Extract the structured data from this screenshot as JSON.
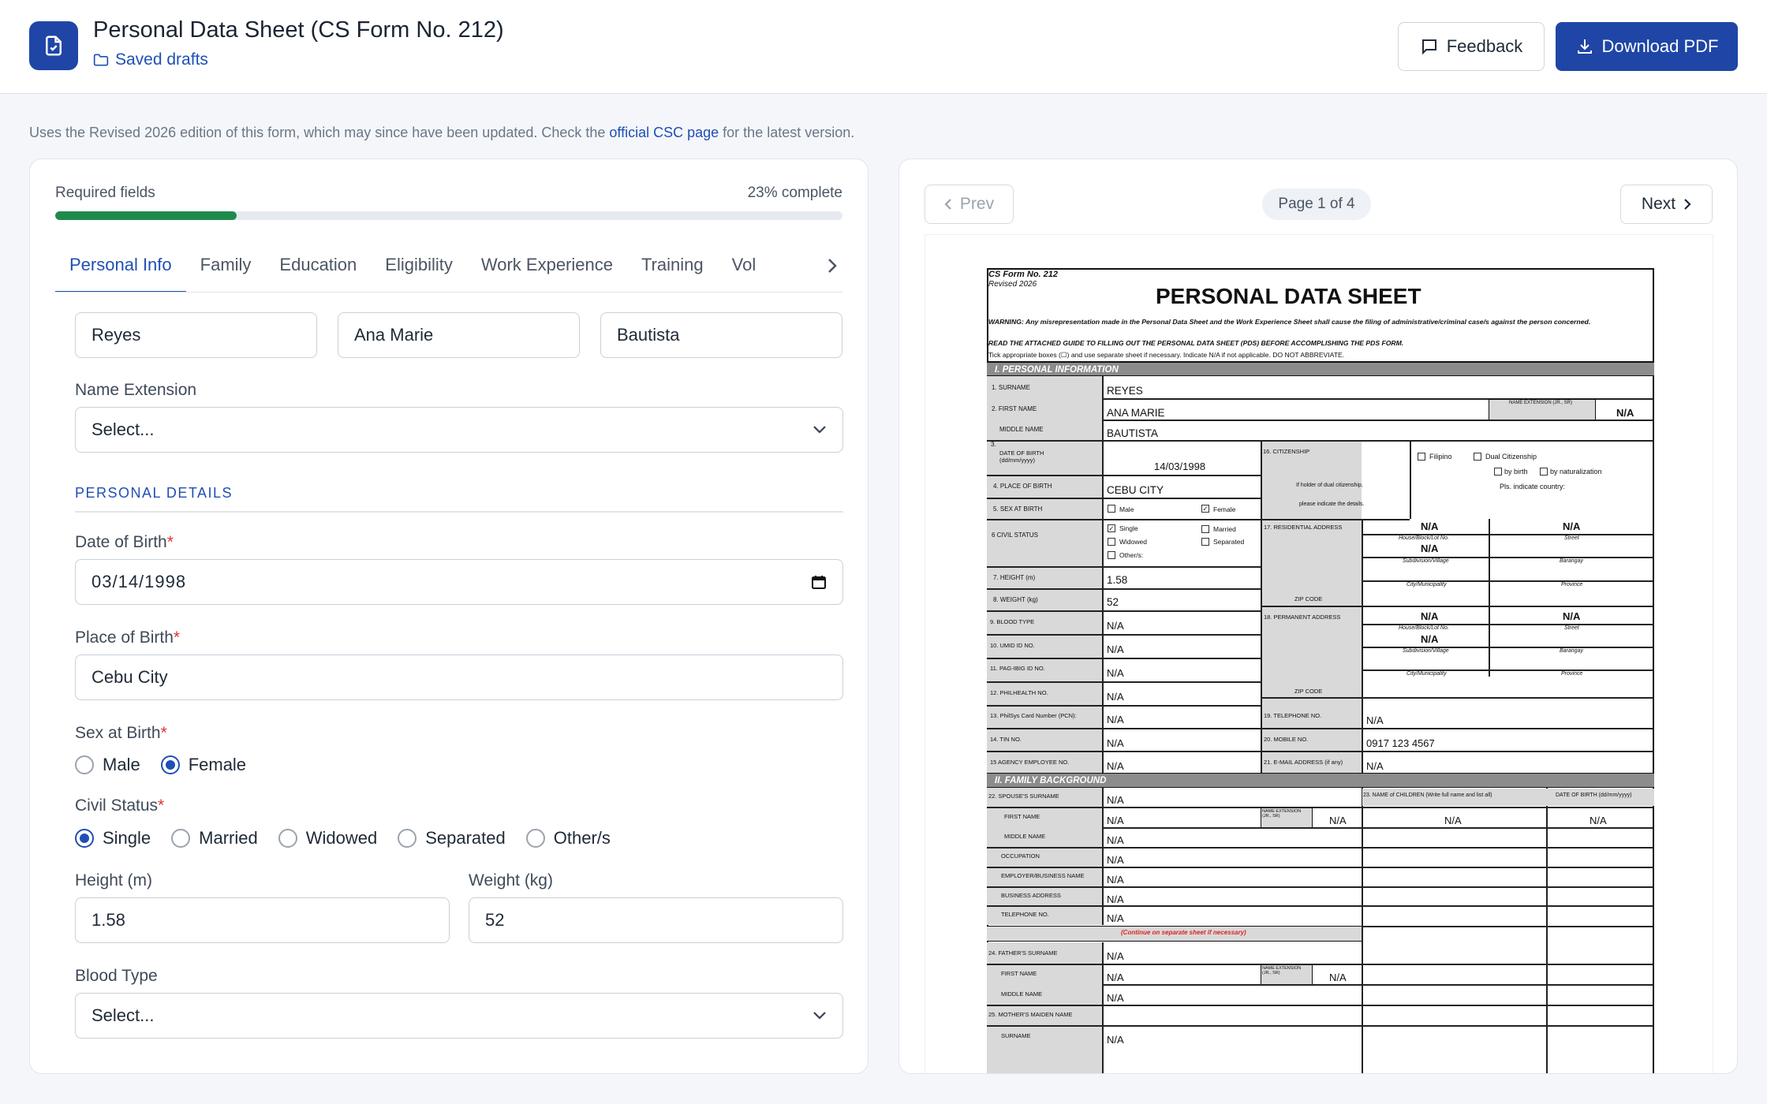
{
  "header": {
    "title": "Personal Data Sheet (CS Form No. 212)",
    "drafts_link": "Saved drafts",
    "feedback_label": "Feedback",
    "download_label": "Download PDF"
  },
  "notice": {
    "prefix": "Uses the Revised 2026 edition of this form, which may since have been updated. Check the ",
    "link": "official CSC page",
    "suffix": " for the latest version."
  },
  "form": {
    "required_label": "Required fields",
    "progress_text": "23% complete",
    "progress_fraction": 0.23,
    "tabs": [
      {
        "label": "Personal Info"
      },
      {
        "label": "Family"
      },
      {
        "label": "Education"
      },
      {
        "label": "Eligibility"
      },
      {
        "label": "Work Experience"
      },
      {
        "label": "Training"
      },
      {
        "label": "Vol"
      }
    ],
    "surname": "Reyes",
    "first_name": "Ana Marie",
    "middle_name": "Bautista",
    "name_extension": {
      "label": "Name Extension",
      "value": "Select..."
    },
    "section_title": "PERSONAL DETAILS",
    "dob": {
      "label": "Date of Birth",
      "value": "03/14/1998"
    },
    "pob": {
      "label": "Place of Birth",
      "value": "Cebu City"
    },
    "sex": {
      "label": "Sex at Birth",
      "options": [
        "Male",
        "Female"
      ],
      "selected": "Female"
    },
    "civil": {
      "label": "Civil Status",
      "options": [
        "Single",
        "Married",
        "Widowed",
        "Separated",
        "Other/s"
      ],
      "selected": "Single"
    },
    "height": {
      "label": "Height (m)",
      "value": "1.58"
    },
    "weight": {
      "label": "Weight (kg)",
      "value": "52"
    },
    "blood": {
      "label": "Blood Type",
      "value": "Select..."
    },
    "required_mark": "*"
  },
  "preview": {
    "prev_label": "Prev",
    "next_label": "Next",
    "page_indicator": "Page 1 of 4"
  },
  "doc": {
    "form_no": "CS Form No. 212",
    "revised": "Revised 2026",
    "title": "PERSONAL DATA SHEET",
    "warning": "WARNING: Any misrepresentation made in the Personal Data Sheet and the Work Experience Sheet shall cause the filing of administrative/criminal case/s against the person concerned.",
    "read": "READ THE ATTACHED GUIDE TO FILLING OUT THE PERSONAL DATA SHEET (PDS) BEFORE ACCOMPLISHING THE PDS FORM.",
    "tick": "Tick appropriate boxes (☐) and use separate sheet if necessary. Indicate N/A if not applicable.  DO NOT ABBREVIATE.",
    "sec1": "I. PERSONAL INFORMATION",
    "sec2": "II.  FAMILY BACKGROUND",
    "surname_lbl": "1.  SURNAME",
    "first_lbl": "2.  FIRST NAME",
    "middle_lbl": "MIDDLE NAME",
    "surname": "REYES",
    "first": "ANA MARIE",
    "middle": "BAUTISTA",
    "ext_lbl": "NAME EXTENSION (JR., SR)",
    "na": "N/A",
    "dob_lbl": "DATE OF BIRTH (dd/mm/yyyy)",
    "dob_num": "3.",
    "dob": "14/03/1998",
    "cit_lbl": "16. CITIZENSHIP",
    "cit_note1": "If holder of  dual citizenship,",
    "cit_note2": "please indicate the details.",
    "filipino": "Filipino",
    "dual": "Dual Citizenship",
    "by_birth": "by birth",
    "by_nat": "by naturalization",
    "country": "Pls. indicate country:",
    "pob_lbl": "4. PLACE OF BIRTH",
    "pob": "CEBU CITY",
    "sex_lbl": "5. SEX AT BIRTH",
    "male": "Male",
    "female": "Female",
    "civil_lbl": "6   CIVIL STATUS",
    "single": "Single",
    "married": "Married",
    "widowed": "Widowed",
    "separated": "Separated",
    "others": "Other/s:",
    "res_lbl": "17. RESIDENTIAL ADDRESS",
    "perm_lbl": "18. PERMANENT ADDRESS",
    "zip": "ZIP CODE",
    "house": "House/Block/Lot No.",
    "street": "Street",
    "subd": "Subdivision/Village",
    "brgy": "Barangay",
    "city": "City/Municipality",
    "prov": "Province",
    "height_lbl": "7. HEIGHT (m)",
    "height": "1.58",
    "weight_lbl": "8. WEIGHT (kg)",
    "weight": "52",
    "blood_lbl": "9.   BLOOD TYPE",
    "umid_lbl": "10. UMID ID NO.",
    "pagibig_lbl": "11. PAG-IBIG ID NO.",
    "phil_lbl": "12. PHILHEALTH NO.",
    "psn_lbl": "13. PhilSys Card Number (PCN):",
    "tin_lbl": "14.  TIN NO.",
    "agency_lbl": "15   AGENCY EMPLOYEE NO.",
    "tel_lbl": "19. TELEPHONE NO.",
    "mob_lbl": "20. MOBILE NO.",
    "email_lbl": "21. E-MAIL ADDRESS (if any)",
    "mobile": "0917 123 4567",
    "sp_sur": "22.  SPOUSE'S SURNAME",
    "sp_first": "FIRST NAME",
    "sp_mid": "MIDDLE NAME",
    "occ": "OCCUPATION",
    "emp": "EMPLOYER/BUSINESS NAME",
    "bus": "BUSINESS ADDRESS",
    "tel": "TELEPHONE NO.",
    "children": "23. NAME of CHILDREN  (Write full name and list all)",
    "child_dob": "DATE OF BIRTH (dd/mm/yyyy)",
    "cont": "(Continue on separate sheet if necessary)",
    "ext_small": "NAME EXTENSION (JR., SR)",
    "fa_sur": "24.  FATHER'S SURNAME",
    "fa_first": "FIRST NAME",
    "fa_mid": "MIDDLE NAME",
    "mo_maiden": "25.  MOTHER'S MAIDEN NAME",
    "mo_sur": "SURNAME"
  }
}
